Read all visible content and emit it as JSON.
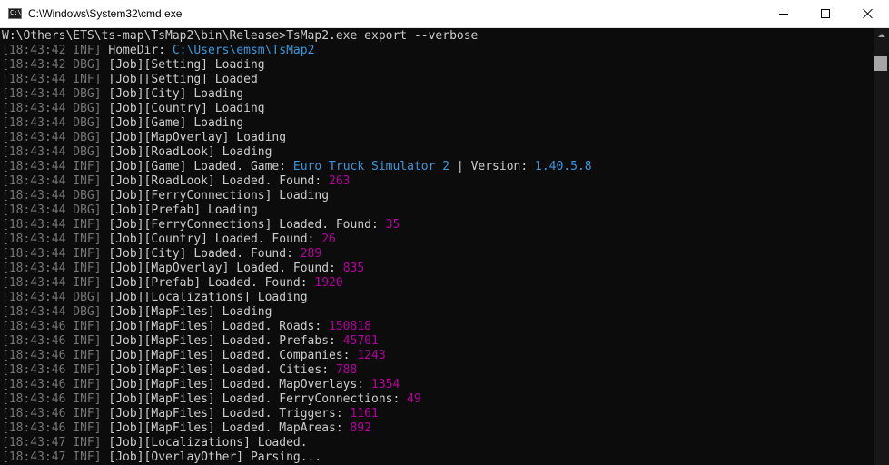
{
  "window": {
    "title": "C:\\Windows\\System32\\cmd.exe",
    "icon": "cmd-icon",
    "icon_label": "C:\\",
    "buttons": {
      "minimize": "minimize-icon",
      "maximize": "maximize-icon",
      "close": "close-icon"
    }
  },
  "colors": {
    "background": "#0c0c0c",
    "text": "#cccccc",
    "timestamp": "#767676",
    "path": "#3a96dd",
    "number": "#b4009e"
  },
  "console": {
    "command": "W:\\Others\\ETS\\ts-map\\TsMap2\\bin\\Release>TsMap2.exe export --verbose",
    "lines": [
      {
        "ts": "[18:43:42 INF]",
        "segments": [
          {
            "t": " HomeDir: ",
            "c": "msg"
          },
          {
            "t": "C:\\Users\\emsm\\TsMap2",
            "c": "path"
          }
        ]
      },
      {
        "ts": "[18:43:42 DBG]",
        "segments": [
          {
            "t": " [Job][Setting] Loading",
            "c": "msg"
          }
        ]
      },
      {
        "ts": "[18:43:44 INF]",
        "segments": [
          {
            "t": " [Job][Setting] Loaded",
            "c": "msg"
          }
        ]
      },
      {
        "ts": "[18:43:44 DBG]",
        "segments": [
          {
            "t": " [Job][City] Loading",
            "c": "msg"
          }
        ]
      },
      {
        "ts": "[18:43:44 DBG]",
        "segments": [
          {
            "t": " [Job][Country] Loading",
            "c": "msg"
          }
        ]
      },
      {
        "ts": "[18:43:44 DBG]",
        "segments": [
          {
            "t": " [Job][Game] Loading",
            "c": "msg"
          }
        ]
      },
      {
        "ts": "[18:43:44 DBG]",
        "segments": [
          {
            "t": " [Job][MapOverlay] Loading",
            "c": "msg"
          }
        ]
      },
      {
        "ts": "[18:43:44 DBG]",
        "segments": [
          {
            "t": " [Job][RoadLook] Loading",
            "c": "msg"
          }
        ]
      },
      {
        "ts": "[18:43:44 INF]",
        "segments": [
          {
            "t": " [Job][Game] Loaded. Game: ",
            "c": "msg"
          },
          {
            "t": "Euro Truck Simulator 2",
            "c": "str"
          },
          {
            "t": " | Version: ",
            "c": "msg"
          },
          {
            "t": "1.40.5.8",
            "c": "str"
          }
        ]
      },
      {
        "ts": "[18:43:44 INF]",
        "segments": [
          {
            "t": " [Job][RoadLook] Loaded. Found: ",
            "c": "msg"
          },
          {
            "t": "263",
            "c": "num"
          }
        ]
      },
      {
        "ts": "[18:43:44 DBG]",
        "segments": [
          {
            "t": " [Job][FerryConnections] Loading",
            "c": "msg"
          }
        ]
      },
      {
        "ts": "[18:43:44 DBG]",
        "segments": [
          {
            "t": " [Job][Prefab] Loading",
            "c": "msg"
          }
        ]
      },
      {
        "ts": "[18:43:44 INF]",
        "segments": [
          {
            "t": " [Job][FerryConnections] Loaded. Found: ",
            "c": "msg"
          },
          {
            "t": "35",
            "c": "num"
          }
        ]
      },
      {
        "ts": "[18:43:44 INF]",
        "segments": [
          {
            "t": " [Job][Country] Loaded. Found: ",
            "c": "msg"
          },
          {
            "t": "26",
            "c": "num"
          }
        ]
      },
      {
        "ts": "[18:43:44 INF]",
        "segments": [
          {
            "t": " [Job][City] Loaded. Found: ",
            "c": "msg"
          },
          {
            "t": "289",
            "c": "num"
          }
        ]
      },
      {
        "ts": "[18:43:44 INF]",
        "segments": [
          {
            "t": " [Job][MapOverlay] Loaded. Found: ",
            "c": "msg"
          },
          {
            "t": "835",
            "c": "num"
          }
        ]
      },
      {
        "ts": "[18:43:44 INF]",
        "segments": [
          {
            "t": " [Job][Prefab] Loaded. Found: ",
            "c": "msg"
          },
          {
            "t": "1920",
            "c": "num"
          }
        ]
      },
      {
        "ts": "[18:43:44 DBG]",
        "segments": [
          {
            "t": " [Job][Localizations] Loading",
            "c": "msg"
          }
        ]
      },
      {
        "ts": "[18:43:44 DBG]",
        "segments": [
          {
            "t": " [Job][MapFiles] Loading",
            "c": "msg"
          }
        ]
      },
      {
        "ts": "[18:43:46 INF]",
        "segments": [
          {
            "t": " [Job][MapFiles] Loaded. Roads: ",
            "c": "msg"
          },
          {
            "t": "150818",
            "c": "num"
          }
        ]
      },
      {
        "ts": "[18:43:46 INF]",
        "segments": [
          {
            "t": " [Job][MapFiles] Loaded. Prefabs: ",
            "c": "msg"
          },
          {
            "t": "45701",
            "c": "num"
          }
        ]
      },
      {
        "ts": "[18:43:46 INF]",
        "segments": [
          {
            "t": " [Job][MapFiles] Loaded. Companies: ",
            "c": "msg"
          },
          {
            "t": "1243",
            "c": "num"
          }
        ]
      },
      {
        "ts": "[18:43:46 INF]",
        "segments": [
          {
            "t": " [Job][MapFiles] Loaded. Cities: ",
            "c": "msg"
          },
          {
            "t": "788",
            "c": "num"
          }
        ]
      },
      {
        "ts": "[18:43:46 INF]",
        "segments": [
          {
            "t": " [Job][MapFiles] Loaded. MapOverlays: ",
            "c": "msg"
          },
          {
            "t": "1354",
            "c": "num"
          }
        ]
      },
      {
        "ts": "[18:43:46 INF]",
        "segments": [
          {
            "t": " [Job][MapFiles] Loaded. FerryConnections: ",
            "c": "msg"
          },
          {
            "t": "49",
            "c": "num"
          }
        ]
      },
      {
        "ts": "[18:43:46 INF]",
        "segments": [
          {
            "t": " [Job][MapFiles] Loaded. Triggers: ",
            "c": "msg"
          },
          {
            "t": "1161",
            "c": "num"
          }
        ]
      },
      {
        "ts": "[18:43:46 INF]",
        "segments": [
          {
            "t": " [Job][MapFiles] Loaded. MapAreas: ",
            "c": "msg"
          },
          {
            "t": "892",
            "c": "num"
          }
        ]
      },
      {
        "ts": "[18:43:47 INF]",
        "segments": [
          {
            "t": " [Job][Localizations] Loaded.",
            "c": "msg"
          }
        ]
      },
      {
        "ts": "[18:43:47 INF]",
        "segments": [
          {
            "t": " [Job][OverlayOther] Parsing...",
            "c": "msg"
          }
        ]
      }
    ]
  },
  "scrollbar": {
    "up_arrow": "chevron-up-icon"
  }
}
